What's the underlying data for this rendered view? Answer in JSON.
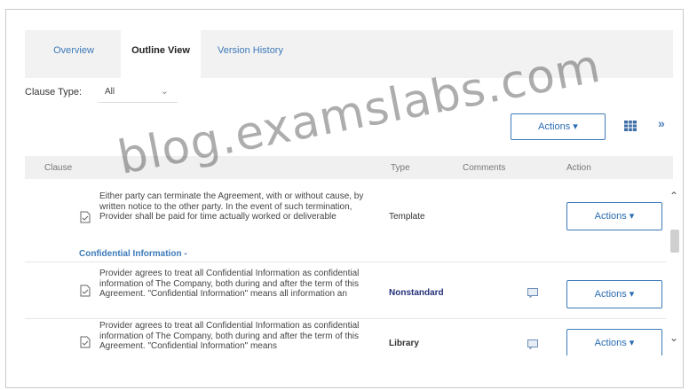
{
  "tabs": [
    {
      "label": "Overview",
      "active": false
    },
    {
      "label": "Outline View",
      "active": true
    },
    {
      "label": "Version History",
      "active": false
    }
  ],
  "filter": {
    "label": "Clause Type:",
    "value": "All"
  },
  "toolbar": {
    "actions_label": "Actions ▾",
    "grid_icon": "grid-icon",
    "expand_icon": "double-chevron-down-icon"
  },
  "table": {
    "headers": {
      "clause": "Clause",
      "type": "Type",
      "comments": "Comments",
      "action": "Action"
    },
    "section_heading": "Confidential Information -",
    "rows": [
      {
        "text": "Either party can terminate the Agreement, with or without cause, by written notice to the other party. In the event of such termination, Provider shall be paid for time actually worked or deliverable",
        "type": "Template",
        "action": "Actions ▾"
      },
      {
        "text": "Provider agrees to treat all Confidential Information as confidential information of The Company, both during and after the term of this Agreement. \"Confidential Information\" means all information an",
        "type": "Nonstandard",
        "action": "Actions ▾"
      },
      {
        "text": "Provider agrees to treat all Confidential Information as confidential information of The Company, both during and after the term of this Agreement. \"Confidential Information\" means",
        "type": "Library",
        "action": "Actions ▾"
      }
    ]
  },
  "watermark": "blog.examslabs.com",
  "colors": {
    "accent": "#3d7ab8",
    "nonstandard": "#24307a",
    "header_bg": "#f0f0f0",
    "tab_bg": "#f2f2f2"
  }
}
